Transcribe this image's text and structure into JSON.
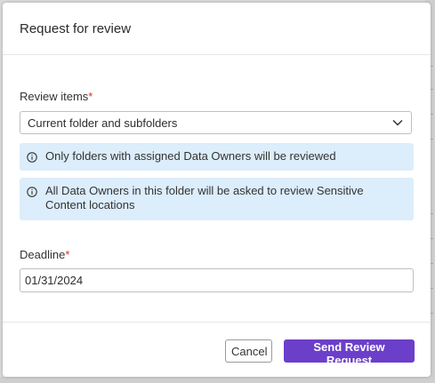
{
  "dialog": {
    "title": "Request for review",
    "review_items": {
      "label": "Review items",
      "required_marker": "*",
      "selected_value": "Current folder and subfolders"
    },
    "info_messages": [
      "Only folders with assigned Data Owners will be reviewed",
      "All Data Owners in this folder will be asked to review Sensitive Content locations"
    ],
    "deadline": {
      "label": "Deadline",
      "required_marker": "*",
      "value": "01/31/2024"
    },
    "buttons": {
      "cancel": "Cancel",
      "submit": "Send Review Request"
    }
  },
  "colors": {
    "primary": "#6b3fc9",
    "info_background": "#dcedfb",
    "required": "#d0312d"
  },
  "icons": {
    "select": "chevron-down-icon",
    "info": "info-icon"
  }
}
